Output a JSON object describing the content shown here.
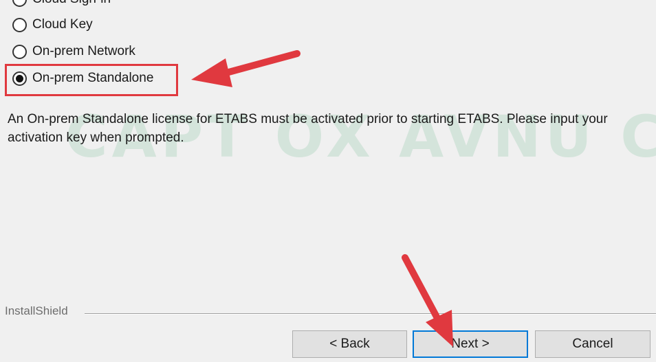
{
  "options": [
    {
      "label": "Cloud Sign-in",
      "checked": false
    },
    {
      "label": "Cloud Key",
      "checked": false
    },
    {
      "label": "On-prem Network",
      "checked": false
    },
    {
      "label": "On-prem Standalone",
      "checked": true
    }
  ],
  "description": "An On-prem Standalone license for ETABS must be activated prior to starting ETABS. Please input your activation key when prompted.",
  "watermark": "CAPT OX AVNU CO",
  "footer": {
    "brand": "InstallShield"
  },
  "buttons": {
    "back": "< Back",
    "next": "Next >",
    "cancel": "Cancel"
  },
  "annotation_color": "#e0393f"
}
